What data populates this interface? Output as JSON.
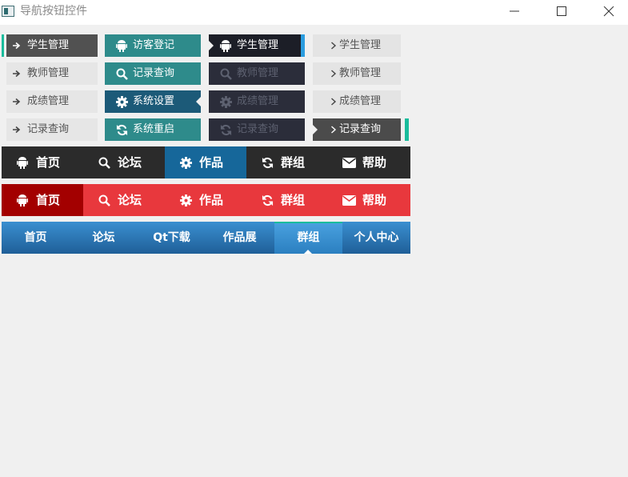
{
  "window": {
    "title": "导航按钮控件",
    "controls": {
      "minimize": "minimize-icon",
      "maximize": "maximize-icon",
      "close": "close-icon"
    }
  },
  "group1": {
    "icon": "arrow-right-icon",
    "items": [
      {
        "label": "学生管理",
        "active": true
      },
      {
        "label": "教师管理",
        "active": false
      },
      {
        "label": "成绩管理",
        "active": false
      },
      {
        "label": "记录查询",
        "active": false
      }
    ]
  },
  "group2": {
    "items": [
      {
        "label": "访客登记",
        "icon": "android-icon",
        "active": false
      },
      {
        "label": "记录查询",
        "icon": "search-icon",
        "active": false
      },
      {
        "label": "系统设置",
        "icon": "gear-icon",
        "active": true
      },
      {
        "label": "系统重启",
        "icon": "refresh-icon",
        "active": false
      }
    ]
  },
  "group3": {
    "items": [
      {
        "label": "学生管理",
        "icon": "android-icon",
        "active": true
      },
      {
        "label": "教师管理",
        "icon": "search-icon",
        "active": false
      },
      {
        "label": "成绩管理",
        "icon": "gear-icon",
        "active": false
      },
      {
        "label": "记录查询",
        "icon": "refresh-icon",
        "active": false
      }
    ]
  },
  "group4": {
    "icon": "chevron-right-icon",
    "items": [
      {
        "label": "学生管理",
        "active": false
      },
      {
        "label": "教师管理",
        "active": false
      },
      {
        "label": "成绩管理",
        "active": false
      },
      {
        "label": "记录查询",
        "active": true
      }
    ]
  },
  "nav_dark": {
    "items": [
      {
        "label": "首页",
        "icon": "android-icon",
        "active": false
      },
      {
        "label": "论坛",
        "icon": "search-icon",
        "active": false
      },
      {
        "label": "作品",
        "icon": "gear-icon",
        "active": true
      },
      {
        "label": "群组",
        "icon": "refresh-icon",
        "active": false
      },
      {
        "label": "帮助",
        "icon": "envelope-icon",
        "active": false
      }
    ]
  },
  "nav_red": {
    "items": [
      {
        "label": "首页",
        "icon": "android-icon",
        "active": true
      },
      {
        "label": "论坛",
        "icon": "search-icon",
        "active": false
      },
      {
        "label": "作品",
        "icon": "gear-icon",
        "active": false
      },
      {
        "label": "群组",
        "icon": "refresh-icon",
        "active": false
      },
      {
        "label": "帮助",
        "icon": "envelope-icon",
        "active": false
      }
    ]
  },
  "nav_blue": {
    "items": [
      {
        "label": "首页",
        "active": false
      },
      {
        "label": "论坛",
        "active": false
      },
      {
        "label": "Qt下载",
        "active": false
      },
      {
        "label": "作品展",
        "active": false
      },
      {
        "label": "群组",
        "active": true
      },
      {
        "label": "个人中心",
        "active": false
      }
    ]
  },
  "colors": {
    "teal": "#1abc9c",
    "blue": "#2b9de0",
    "red": "#e8383d",
    "dark_red": "#a30000",
    "steel_blue": "#16679a"
  }
}
